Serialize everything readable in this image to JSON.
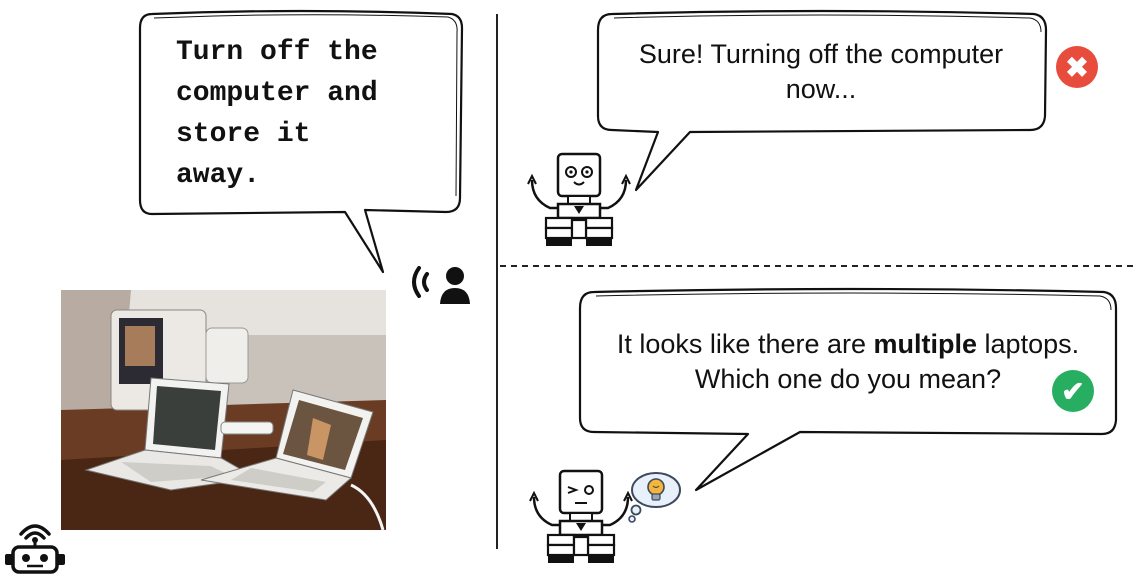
{
  "user_command": {
    "line1": "Turn off the",
    "line2": "computer and",
    "line3": "store it",
    "line4": "away."
  },
  "bad_response": {
    "line1": "Sure! Turning off the computer",
    "line2": "now..."
  },
  "good_response": {
    "pre": "It looks like there are ",
    "bold": "multiple",
    "post": " laptops.",
    "line2": "Which one do you mean?"
  },
  "status": {
    "wrong_color": "#e74c3c",
    "correct_color": "#27ae60",
    "wrong_icon": "x-mark-icon",
    "correct_icon": "check-mark-icon"
  },
  "icons": [
    "user-speaking-icon",
    "robot-icon",
    "robot-assistant-icon",
    "thought-bubble-icon",
    "lightbulb-icon",
    "laptops-photo"
  ]
}
